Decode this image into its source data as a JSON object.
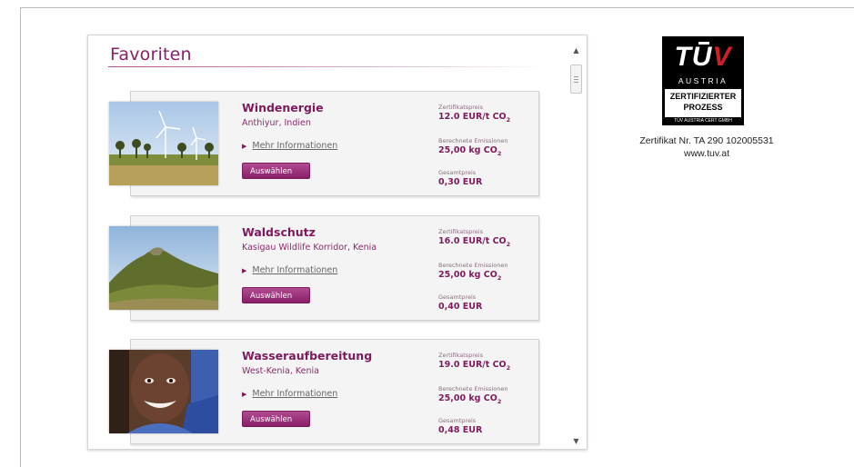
{
  "panel": {
    "title": "Favoriten",
    "projects": [
      {
        "name": "Windenergie",
        "location": "Anthiyur, Indien",
        "more_label": "Mehr Informationen",
        "select_label": "Auswählen",
        "price_label": "Zertifikatspreis",
        "price_value": "12.0 EUR/t CO",
        "emission_label": "Berechnete Emissionen",
        "emission_value": "25,00 kg CO",
        "total_label": "Gesamtpreis",
        "total_value": "0,30 EUR"
      },
      {
        "name": "Waldschutz",
        "location": "Kasigau Wildlife Korridor, Kenia",
        "more_label": "Mehr Informationen",
        "select_label": "Auswählen",
        "price_label": "Zertifikatspreis",
        "price_value": "16.0 EUR/t CO",
        "emission_label": "Berechnete Emissionen",
        "emission_value": "25,00 kg CO",
        "total_label": "Gesamtpreis",
        "total_value": "0,40 EUR"
      },
      {
        "name": "Wasseraufbereitung",
        "location": "West-Kenia, Kenia",
        "more_label": "Mehr Informationen",
        "select_label": "Auswählen",
        "price_label": "Zertifikatspreis",
        "price_value": "19.0 EUR/t CO",
        "emission_label": "Berechnete Emissionen",
        "emission_value": "25,00 kg CO",
        "total_label": "Gesamtpreis",
        "total_value": "0,48 EUR"
      }
    ],
    "co2_subscript": "2"
  },
  "tuv": {
    "logo_tu": "TU",
    "logo_v": "V",
    "austria": "AUSTRIA",
    "line1": "ZERTIFIZIERTER",
    "line2": "PROZESS",
    "cert_gmbh": "TÜV AUSTRIA CERT GMBH",
    "cert_number": "Zertifikat Nr. TA 290 102005531",
    "url": "www.tuv.at"
  },
  "colors": {
    "accent": "#8a1f67",
    "button": "#a03a82",
    "card_bg": "#f4f4f4"
  }
}
